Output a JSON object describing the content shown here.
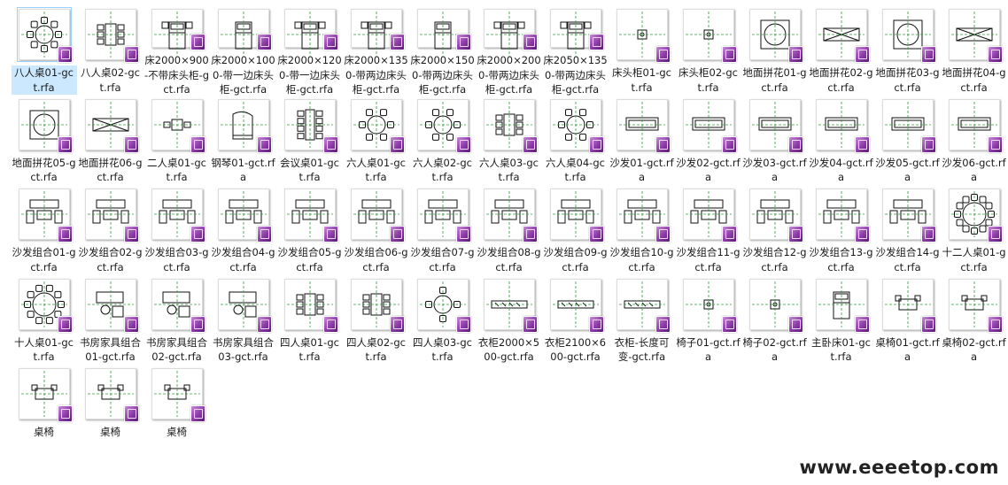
{
  "files": [
    {
      "name": "八人桌01-gct.rfa",
      "icon": "round-table-8-icon"
    },
    {
      "name": "八人桌02-gct.rfa",
      "icon": "rect-table-8-icon"
    },
    {
      "name": "床2000×900-不带床头柜-gct.rfa",
      "icon": "bed-icon"
    },
    {
      "name": "床2000×1000-带一边床头柜-gct.rfa",
      "icon": "bed-icon"
    },
    {
      "name": "床2000×1200-带一边床头柜-gct.rfa",
      "icon": "bed-icon"
    },
    {
      "name": "床2000×1350-带两边床头柜-gct.rfa",
      "icon": "bed-icon"
    },
    {
      "name": "床2000×1500-带两边床头柜-gct.rfa",
      "icon": "bed-icon"
    },
    {
      "name": "床2000×2000-带两边床头柜-gct.rfa",
      "icon": "bed-icon"
    },
    {
      "name": "床2050×1350-带两边床头柜-gct.rfa",
      "icon": "bed-icon"
    },
    {
      "name": "床头柜01-gct.rfa",
      "icon": "nightstand-icon"
    },
    {
      "name": "床头柜02-gct.rfa",
      "icon": "nightstand-icon"
    },
    {
      "name": "地面拼花01-gct.rfa",
      "icon": "floor-pattern-icon"
    },
    {
      "name": "地面拼花02-gct.rfa",
      "icon": "floor-pattern-icon"
    },
    {
      "name": "地面拼花03-gct.rfa",
      "icon": "floor-pattern-icon"
    },
    {
      "name": "地面拼花04-gct.rfa",
      "icon": "floor-pattern-icon"
    },
    {
      "name": "地面拼花05-gct.rfa",
      "icon": "floor-pattern-icon"
    },
    {
      "name": "地面拼花06-gct.rfa",
      "icon": "floor-pattern-icon"
    },
    {
      "name": "二人桌01-gct.rfa",
      "icon": "table-2-icon"
    },
    {
      "name": "钢琴01-gct.rfa",
      "icon": "piano-icon"
    },
    {
      "name": "会议桌01-gct.rfa",
      "icon": "conference-table-icon"
    },
    {
      "name": "六人桌01-gct.rfa",
      "icon": "round-table-6-icon"
    },
    {
      "name": "六人桌02-gct.rfa",
      "icon": "round-table-6-icon"
    },
    {
      "name": "六人桌03-gct.rfa",
      "icon": "rect-table-6-icon"
    },
    {
      "name": "六人桌04-gct.rfa",
      "icon": "round-table-6-icon"
    },
    {
      "name": "沙发01-gct.rfa",
      "icon": "sofa-icon"
    },
    {
      "name": "沙发02-gct.rfa",
      "icon": "sofa-icon"
    },
    {
      "name": "沙发03-gct.rfa",
      "icon": "sofa-icon"
    },
    {
      "name": "沙发04-gct.rfa",
      "icon": "sofa-icon"
    },
    {
      "name": "沙发05-gct.rfa",
      "icon": "sofa-icon"
    },
    {
      "name": "沙发06-gct.rfa",
      "icon": "sofa-icon"
    },
    {
      "name": "沙发组合01-gct.rfa",
      "icon": "sofa-set-icon"
    },
    {
      "name": "沙发组合02-gct.rfa",
      "icon": "sofa-set-icon"
    },
    {
      "name": "沙发组合03-gct.rfa",
      "icon": "sofa-set-icon"
    },
    {
      "name": "沙发组合04-gct.rfa",
      "icon": "sofa-set-icon"
    },
    {
      "name": "沙发组合05-gct.rfa",
      "icon": "sofa-set-icon"
    },
    {
      "name": "沙发组合06-gct.rfa",
      "icon": "sofa-set-icon"
    },
    {
      "name": "沙发组合07-gct.rfa",
      "icon": "sofa-set-icon"
    },
    {
      "name": "沙发组合08-gct.rfa",
      "icon": "sofa-set-icon"
    },
    {
      "name": "沙发组合09-gct.rfa",
      "icon": "sofa-set-icon"
    },
    {
      "name": "沙发组合10-gct.rfa",
      "icon": "sofa-set-icon"
    },
    {
      "name": "沙发组合11-gct.rfa",
      "icon": "sofa-set-icon"
    },
    {
      "name": "沙发组合12-gct.rfa",
      "icon": "sofa-set-icon"
    },
    {
      "name": "沙发组合13-gct.rfa",
      "icon": "sofa-set-icon"
    },
    {
      "name": "沙发组合14-gct.rfa",
      "icon": "sofa-set-icon"
    },
    {
      "name": "十二人桌01-gct.rfa",
      "icon": "round-table-12-icon"
    },
    {
      "name": "十人桌01-gct.rfa",
      "icon": "round-table-10-icon"
    },
    {
      "name": "书房家具组合01-gct.rfa",
      "icon": "study-furniture-icon"
    },
    {
      "name": "书房家具组合02-gct.rfa",
      "icon": "study-furniture-icon"
    },
    {
      "name": "书房家具组合03-gct.rfa",
      "icon": "study-furniture-icon"
    },
    {
      "name": "四人桌01-gct.rfa",
      "icon": "table-4-icon"
    },
    {
      "name": "四人桌02-gct.rfa",
      "icon": "table-4-icon"
    },
    {
      "name": "四人桌03-gct.rfa",
      "icon": "round-table-4-icon"
    },
    {
      "name": "衣柜2000×500-gct.rfa",
      "icon": "wardrobe-icon"
    },
    {
      "name": "衣柜2100×600-gct.rfa",
      "icon": "wardrobe-icon"
    },
    {
      "name": "衣柜-长度可变-gct.rfa",
      "icon": "wardrobe-icon"
    },
    {
      "name": "椅子01-gct.rfa",
      "icon": "chair-icon"
    },
    {
      "name": "椅子02-gct.rfa",
      "icon": "chair-icon"
    },
    {
      "name": "主卧床01-gct.rfa",
      "icon": "master-bed-icon"
    },
    {
      "name": "桌椅01-gct.rfa",
      "icon": "table-chair-icon"
    },
    {
      "name": "桌椅02-gct.rfa",
      "icon": "table-chair-icon"
    },
    {
      "name": "桌椅",
      "icon": "table-chair-icon"
    },
    {
      "name": "桌椅",
      "icon": "table-chair-icon"
    },
    {
      "name": "桌椅",
      "icon": "table-chair-icon"
    }
  ],
  "watermark": "www.eeeetop.com"
}
